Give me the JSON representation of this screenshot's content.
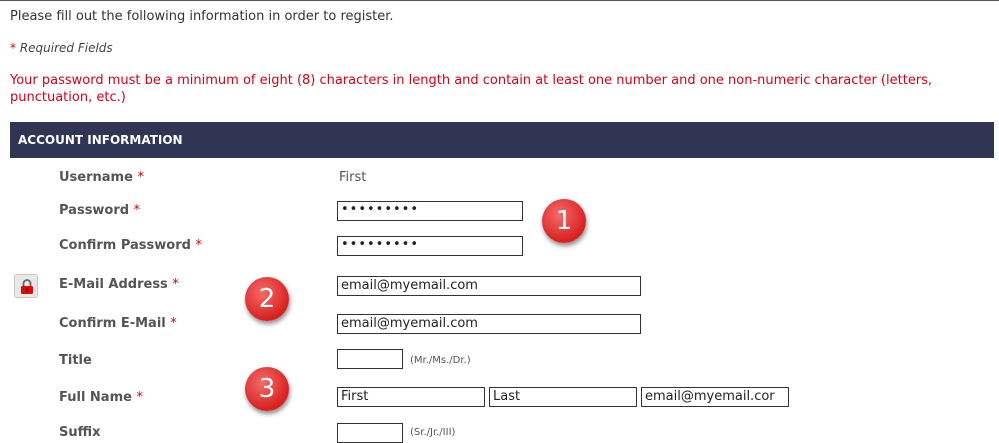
{
  "intro": "Please fill out the following information in order to register.",
  "required_note": {
    "star": "*",
    "text": "Required Fields"
  },
  "password_note": "Your password must be a minimum of eight (8) characters in length and contain at least one number and one non-numeric character (letters, punctuation, etc.)",
  "section_title": "ACCOUNT INFORMATION",
  "required_star": "*",
  "fields": {
    "username": {
      "label": "Username",
      "value": "First"
    },
    "password": {
      "label": "Password",
      "value": "•••••••••"
    },
    "confirm_password": {
      "label": "Confirm Password",
      "value": "•••••••••"
    },
    "email": {
      "label": "E-Mail Address",
      "value": "email@myemail.com"
    },
    "confirm_email": {
      "label": "Confirm E-Mail",
      "value": "email@myemail.com"
    },
    "title": {
      "label": "Title",
      "value": "",
      "hint": "(Mr./Ms./Dr.)"
    },
    "full_name": {
      "label": "Full Name",
      "first": "First",
      "last": "Last",
      "extra": "email@myemail.cor"
    },
    "suffix": {
      "label": "Suffix",
      "value": "",
      "hint": "(Sr./Jr./III)"
    }
  },
  "badges": [
    "1",
    "2",
    "3"
  ],
  "colors": {
    "header_bar": "#2f3552",
    "warning_text": "#d0021b",
    "badge": "#d92020"
  }
}
